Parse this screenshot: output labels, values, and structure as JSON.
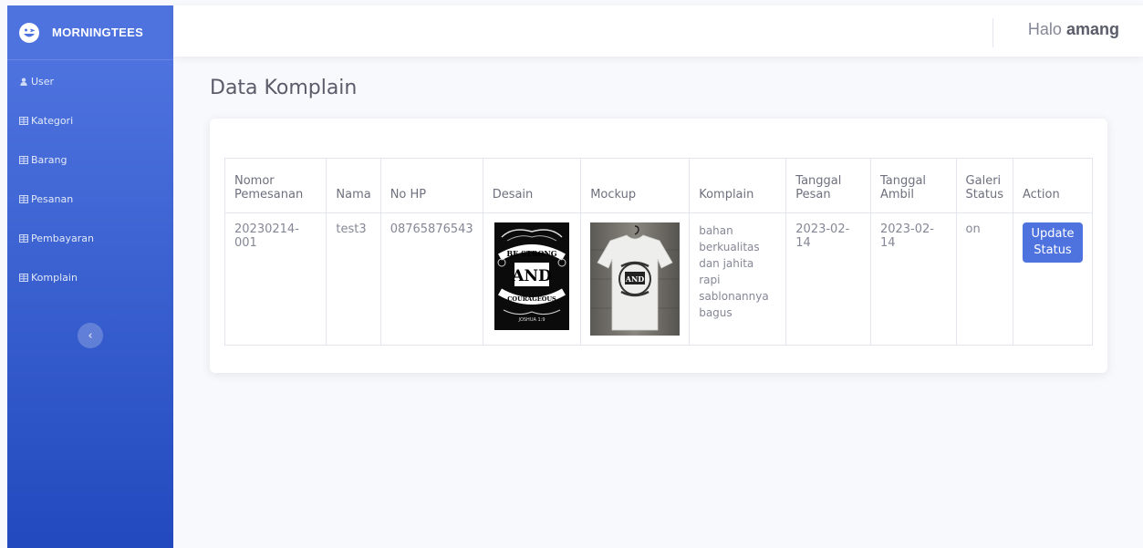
{
  "brand": {
    "name": "MORNINGTEES",
    "logo_icon": "laugh-icon"
  },
  "colors": {
    "primary": "#4e73df",
    "sidebar_bottom": "#224abe",
    "background": "#f8f9fc"
  },
  "sidebar": {
    "items": [
      {
        "label": "User",
        "icon": "user-icon"
      },
      {
        "label": "Kategori",
        "icon": "table-icon"
      },
      {
        "label": "Barang",
        "icon": "table-icon"
      },
      {
        "label": "Pesanan",
        "icon": "table-icon"
      },
      {
        "label": "Pembayaran",
        "icon": "table-icon"
      },
      {
        "label": "Komplain",
        "icon": "table-icon"
      }
    ],
    "toggle_glyph": "‹"
  },
  "topbar": {
    "greeting": "Halo",
    "username": "amang"
  },
  "page": {
    "title": "Data Komplain"
  },
  "table": {
    "headers": {
      "nomor": "Nomor Pemesanan",
      "nama": "Nama",
      "nohp": "No HP",
      "desain": "Desain",
      "mockup": "Mockup",
      "komplain": "Komplain",
      "tgl_pesan": "Tanggal Pesan",
      "tgl_ambil": "Tanggal Ambil",
      "galeri": "Galeri Status",
      "action": "Action"
    },
    "rows": [
      {
        "nomor": "20230214-001",
        "nama": "test3",
        "nohp": "08765876543",
        "desain_text": [
          "BE STRONG",
          "AND",
          "COURAGEOUS",
          "JOSHUA 1:9"
        ],
        "komplain": "bahan berkualitas dan jahita rapi sablonannya bagus",
        "tgl_pesan": "2023-02-14",
        "tgl_ambil": "2023-02-14",
        "galeri": "on",
        "action_label": "Update Status"
      }
    ]
  }
}
